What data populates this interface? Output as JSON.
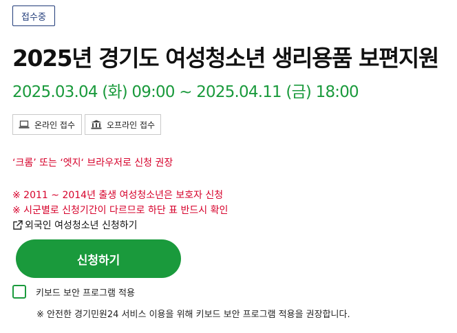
{
  "status": {
    "badge": "접수중"
  },
  "header": {
    "title": "2025년 경기도 여성청소년 생리용품 보편지원",
    "period": "2025.03.04 (화) 09:00 ~ 2025.04.11 (금) 18:00"
  },
  "methods": [
    {
      "label": "온라인 접수",
      "icon": "laptop-icon"
    },
    {
      "label": "오프라인 접수",
      "icon": "bank-building-icon"
    }
  ],
  "notes": {
    "browser": "‘크롬’ 또는 ‘엣지‘ 브라우저로 신청 권장",
    "lines": [
      "※ 2011 ~ 2014년 출생 여성청소년은 보호자 신청",
      "※ 시군별로 신청기간이 다르므로 하단 표 반드시 확인"
    ],
    "foreigner_link": "외국인 여성청소년 신청하기"
  },
  "actions": {
    "apply_label": "신청하기"
  },
  "keyboard_security": {
    "label": "키보드 보안 프로그램 적용",
    "checked": false,
    "note": "※ 안전한 경기민원24 서비스 이용을 위해 키보드 보안 프로그램 적용을 권장합니다."
  },
  "colors": {
    "accent": "#1a9a3c",
    "notice": "#d6002a",
    "badge": "#1f3a78"
  }
}
